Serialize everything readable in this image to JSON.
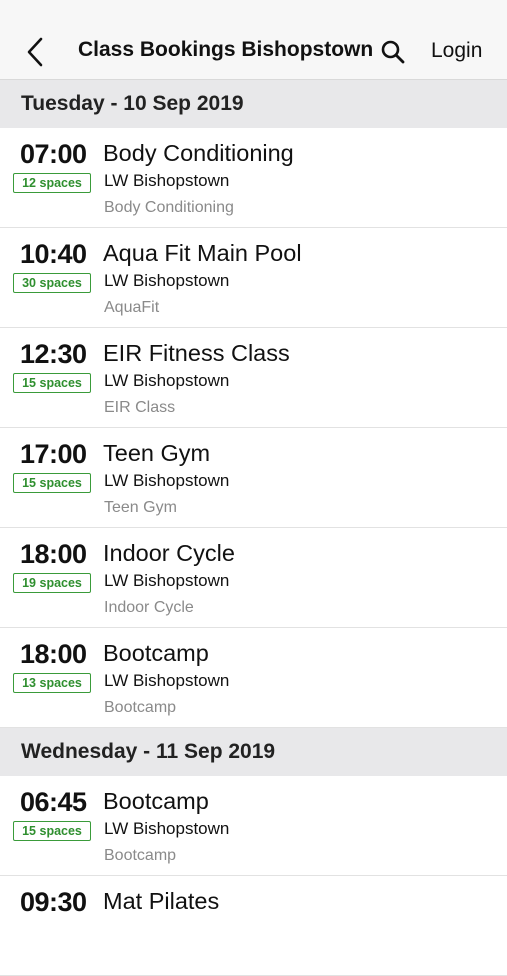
{
  "nav": {
    "title": "Class Bookings Bishopstown",
    "login_label": "Login"
  },
  "days": [
    {
      "date_label": "Tuesday - 10 Sep 2019",
      "classes": [
        {
          "time": "07:00",
          "spaces": "12 spaces",
          "name": "Body Conditioning",
          "location": "LW Bishopstown",
          "category": "Body Conditioning"
        },
        {
          "time": "10:40",
          "spaces": "30 spaces",
          "name": "Aqua Fit Main Pool",
          "location": "LW Bishopstown",
          "category": "AquaFit"
        },
        {
          "time": "12:30",
          "spaces": "15 spaces",
          "name": "EIR Fitness Class",
          "location": "LW Bishopstown",
          "category": "EIR Class"
        },
        {
          "time": "17:00",
          "spaces": "15 spaces",
          "name": "Teen Gym",
          "location": "LW Bishopstown",
          "category": "Teen Gym"
        },
        {
          "time": "18:00",
          "spaces": "19 spaces",
          "name": "Indoor Cycle",
          "location": "LW Bishopstown",
          "category": "Indoor Cycle"
        },
        {
          "time": "18:00",
          "spaces": "13 spaces",
          "name": "Bootcamp",
          "location": "LW Bishopstown",
          "category": "Bootcamp"
        }
      ]
    },
    {
      "date_label": "Wednesday - 11 Sep 2019",
      "classes": [
        {
          "time": "06:45",
          "spaces": "15 spaces",
          "name": "Bootcamp",
          "location": "LW Bishopstown",
          "category": "Bootcamp"
        },
        {
          "time": "09:30",
          "spaces": "",
          "name": "Mat Pilates",
          "location": "",
          "category": ""
        }
      ]
    }
  ],
  "colors": {
    "accent_green": "#2f8f2f",
    "header_bg": "#e8e8ea",
    "nav_bg": "#f7f7f7"
  }
}
